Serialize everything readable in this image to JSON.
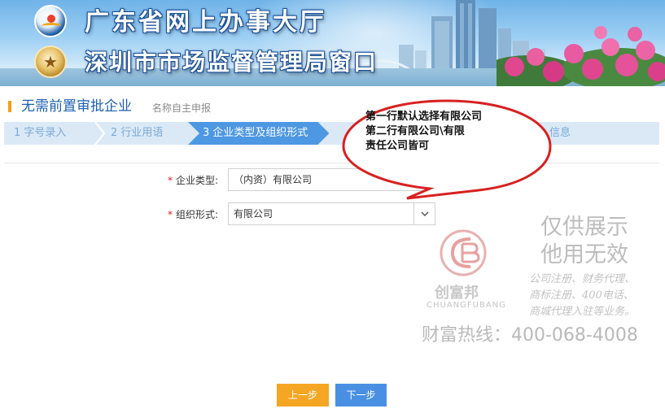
{
  "banner": {
    "title": "广东省网上办事大厅",
    "subtitle": "深圳市市场监督管理局窗口"
  },
  "section": {
    "title": "无需前置审批企业",
    "note": "名称自主申报"
  },
  "steps": [
    {
      "label": "1 字号录入",
      "active": false
    },
    {
      "label": "2 行业用语",
      "active": false
    },
    {
      "label": "3 企业类型及组织形式",
      "active": true
    },
    {
      "label": "信息",
      "active": false
    }
  ],
  "form": {
    "company_type": {
      "label": "企业类型:",
      "value": "（内资）有限公司"
    },
    "org_form": {
      "label": "组织形式:",
      "value": "有限公司"
    }
  },
  "callout": {
    "lines": [
      "第一行默认选择有限公司",
      "第二行有限公司\\有限",
      "责任公司皆可"
    ]
  },
  "watermark": {
    "line1": "仅供展示",
    "line2": "他用无效",
    "service1": "公司注册、财务代理、",
    "service2": "商标注册、400电话、",
    "service3": "商城代理入驻等业务。",
    "brand_cn": "创富邦",
    "brand_en": "CHUANGFUBANG",
    "hotline": "财富热线：400-068-4008"
  },
  "buttons": {
    "prev": "上一步",
    "next": "下一步"
  },
  "colors": {
    "accent_blue": "#4d97e3",
    "prev_button": "#f5a623",
    "next_button": "#4a90e2",
    "title_blue": "#1b5fb0",
    "required_red": "#e02020"
  }
}
